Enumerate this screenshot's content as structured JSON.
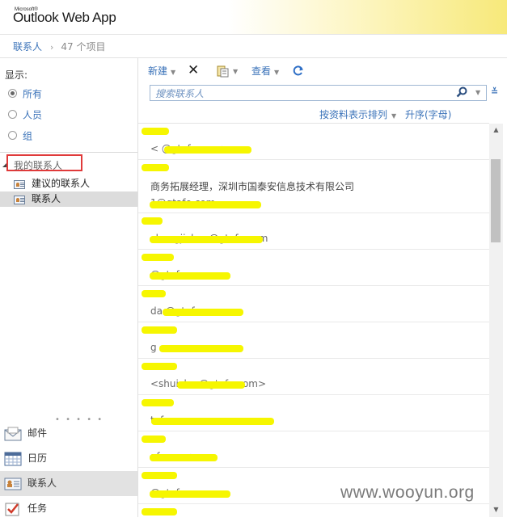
{
  "header": {
    "ms_label": "Microsoft®",
    "app_name": "Outlook Web App"
  },
  "breadcrumb": {
    "folder": "联系人",
    "separator": "›",
    "item_count": "47 个项目"
  },
  "nav": {
    "show_label": "显示:",
    "filters": [
      {
        "label": "所有",
        "selected": true
      },
      {
        "label": "人员",
        "selected": false
      },
      {
        "label": "组",
        "selected": false
      }
    ],
    "my_contacts": "我的联系人",
    "folders": [
      {
        "label": "建议的联系人",
        "icon": "contact-card-icon",
        "selected": false
      },
      {
        "label": "联系人",
        "icon": "contact-card-icon",
        "selected": true
      }
    ],
    "grip": "• • • • •",
    "modules": [
      {
        "label": "邮件",
        "icon": "mail-icon",
        "selected": false
      },
      {
        "label": "日历",
        "icon": "calendar-icon",
        "selected": false
      },
      {
        "label": "联系人",
        "icon": "contacts-icon",
        "selected": true
      },
      {
        "label": "任务",
        "icon": "tasks-icon",
        "selected": false
      }
    ]
  },
  "toolbar": {
    "new_label": "新建",
    "delete_icon": "✕",
    "view_label": "查看"
  },
  "search": {
    "placeholder": "搜索联系人",
    "value": ""
  },
  "sort": {
    "by_label": "按资料表示排列",
    "order_label": "升序(字母)"
  },
  "contacts": [
    {
      "lines": [
        "<       @gtafe.com>"
      ]
    },
    {
      "lines": [
        "商务拓展经理，深圳市国泰安信息技术有限公司",
        "        1@gtafe.com"
      ]
    },
    {
      "lines": [
        "chengjichen@gtafe.com"
      ]
    },
    {
      "lines": [
        "        @gtafe.com"
      ]
    },
    {
      "lines": [
        "da        @gtafe.com"
      ]
    },
    {
      "lines": [
        "g      .com"
      ]
    },
    {
      "lines": [
        "<shuiche      @gtafe.com>"
      ]
    },
    {
      "lines": [
        "           tafe.com"
      ]
    },
    {
      "lines": [
        "           afe.com>"
      ]
    },
    {
      "lines": [
        "            @gtafe.com"
      ]
    },
    {
      "lines": [
        ""
      ]
    }
  ],
  "watermark": "www.wooyun.org",
  "colors": {
    "link": "#3b73b9",
    "highlight": "#f6f600",
    "annotation_box": "#e03a3a"
  }
}
